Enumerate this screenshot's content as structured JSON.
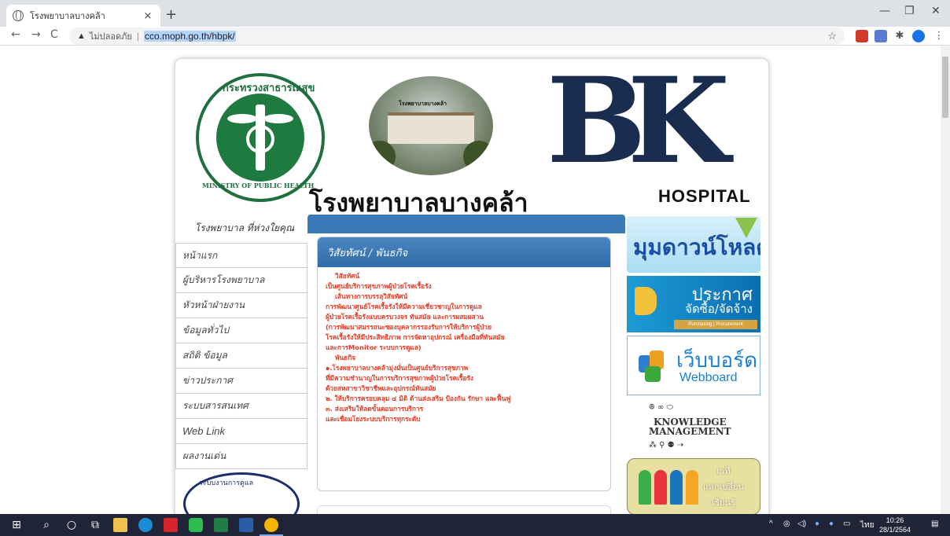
{
  "browser": {
    "tab_title": "โรงพยาบาลบางคล้า",
    "tab_close": "×",
    "new_tab": "+",
    "minimize": "—",
    "maximize": "❐",
    "close": "✕",
    "back": "←",
    "forward": "→",
    "reload": "C",
    "security_label": "ไม่ปลอดภัย",
    "separator": "|",
    "url": "cco.moph.go.th/hbpk/",
    "bookmark_star": "☆"
  },
  "header": {
    "moph_top_text": "กระทรวงสาธารณสุข",
    "moph_bottom_text": "MINISTRY OF PUBLIC HEALTH",
    "photo_sign": "โรงพยาบาลบางคล้า",
    "bk_logo": "BK",
    "hospital_name_th": "โรงพยาบาลบางคล้า",
    "hospital_name_en": "HOSPITAL"
  },
  "sidebar": {
    "slogan": "โรงพยาบาล ที่ห่วงใยคุณ",
    "items": [
      {
        "label": "หน้าแรก"
      },
      {
        "label": "ผู้บริหารโรงพยาบาล"
      },
      {
        "label": "หัวหน้าฝ่ายงาน"
      },
      {
        "label": "ข้อมูลทั่วไป"
      },
      {
        "label": "สถิติ ข้อมูล"
      },
      {
        "label": "ข่าวประกาศ"
      },
      {
        "label": "ระบบสารสนเทศ"
      },
      {
        "label": "Web Link"
      },
      {
        "label": "ผลงานเด่น"
      }
    ],
    "seal_text": "ระบบงานการดูแล"
  },
  "main": {
    "panel_title": "วิสัยทัศน์ / พันธกิจ",
    "lines": [
      {
        "text": "วิสัยทัศน์",
        "indent": true
      },
      {
        "text": "เป็นศูนย์บริการสุขภาพผู้ป่วยโรคเรื้อรัง",
        "indent": false
      },
      {
        "text": "เส้นทางการบรรลุวิสัยทัศน์",
        "indent": true
      },
      {
        "text": "การพัฒนาศูนย์โรคเรื้อรังให้มีความเชี่ยวชาญในการดูแล",
        "indent": false
      },
      {
        "text": "ผู้ป่วยโรคเรื้อรังแบบครบวงจร ทันสมัย และการผสมผสาน",
        "indent": false
      },
      {
        "text": "(การพัฒนาสมรรถนะของบุคลากรรองรับการให้บริการผู้ป่วย",
        "indent": false
      },
      {
        "text": "โรคเรื้อรังให้มีประสิทธิภาพ การจัดหาอุปกรณ์ เครื่องมือที่ทันสมัย",
        "indent": false
      },
      {
        "text": "และการMonitor ระบบการดูแล)",
        "indent": false
      },
      {
        "text": "พันธกิจ",
        "indent": true
      },
      {
        "text": "๑.โรงพยาบาลบางคล้ามุ่งมั่นเป็นศูนย์บริการสุขภาพ",
        "indent": false
      },
      {
        "text": "ที่มีความชำนาญในการบริการสุขภาพผู้ป่วยโรคเรื้อรัง",
        "indent": false
      },
      {
        "text": "ด้วยสหสาขาวิชาชีพและอุปกรณ์ทันสมัย",
        "indent": false
      },
      {
        "text": "๒. ให้บริการครอบคลุม ๔ มิติ ด้านส่งเสริม ป้องกัน รักษา และฟื้นฟู",
        "indent": false
      },
      {
        "text": "๓. ส่งเสริมให้ลดขั้นตอนการบริการ",
        "indent": false
      },
      {
        "text": "และเชื่อมโยงระบบบริการทุกระดับ",
        "indent": false
      }
    ]
  },
  "banners": {
    "download": "มุมดาวน์โหลด",
    "procure_1": "ประกาศ",
    "procure_2": "จัดซื้อ/จัดจ้าง",
    "procure_3": "Purchasing | Procurement",
    "webboard_th": "เว็บบอร์ด",
    "webboard_en": "Webboard",
    "km_1": "KNOWLEDGE",
    "km_2": "MANAGEMENT",
    "km_icons": "ꔮ ∞ ⬭",
    "km_icons2": "⁂ ⚲ ⚉ ⇢",
    "vt_1": "เวที",
    "vt_2": "แลกเปลี่ยน",
    "vt_3": "เรียนรู้"
  },
  "taskbar": {
    "tray_lang": "ไทย",
    "time": "10:26",
    "date": "28/1/2564"
  },
  "colors": {
    "accent_blue": "#3a7ab6",
    "mission_text": "#e43b24",
    "moph_green": "#1f7a40",
    "bk_navy": "#1b2d4f"
  }
}
